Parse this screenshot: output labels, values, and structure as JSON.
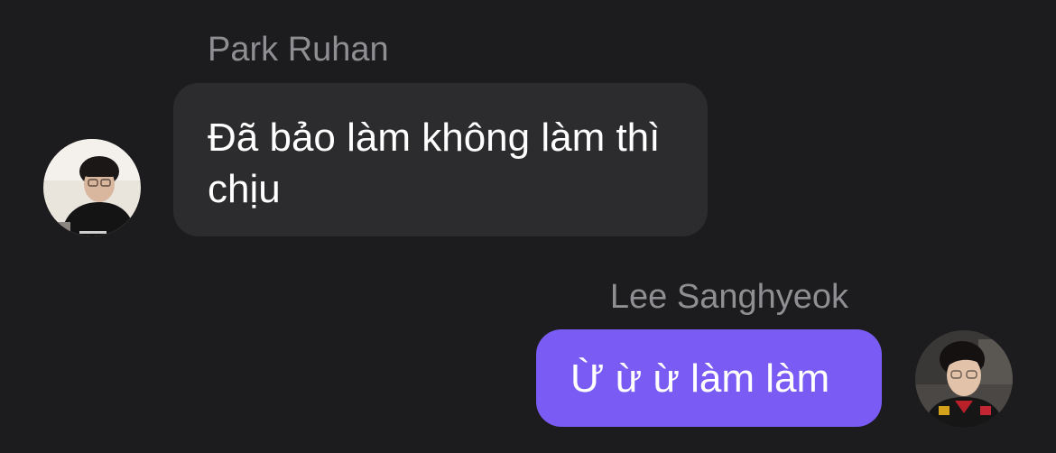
{
  "messages": [
    {
      "sender": "Park Ruhan",
      "text": "Đã bảo làm không làm thì chịu",
      "direction": "incoming",
      "avatar_icon": "avatar-photo"
    },
    {
      "sender": "Lee Sanghyeok",
      "text": "Ừ ừ ừ làm làm",
      "direction": "outgoing",
      "avatar_icon": "avatar-photo"
    }
  ],
  "colors": {
    "background": "#1c1c1e",
    "incoming_bubble": "#2c2c2e",
    "outgoing_bubble": "#7a5cf5",
    "sender_name": "#8e8e93",
    "message_text": "#ffffff"
  }
}
